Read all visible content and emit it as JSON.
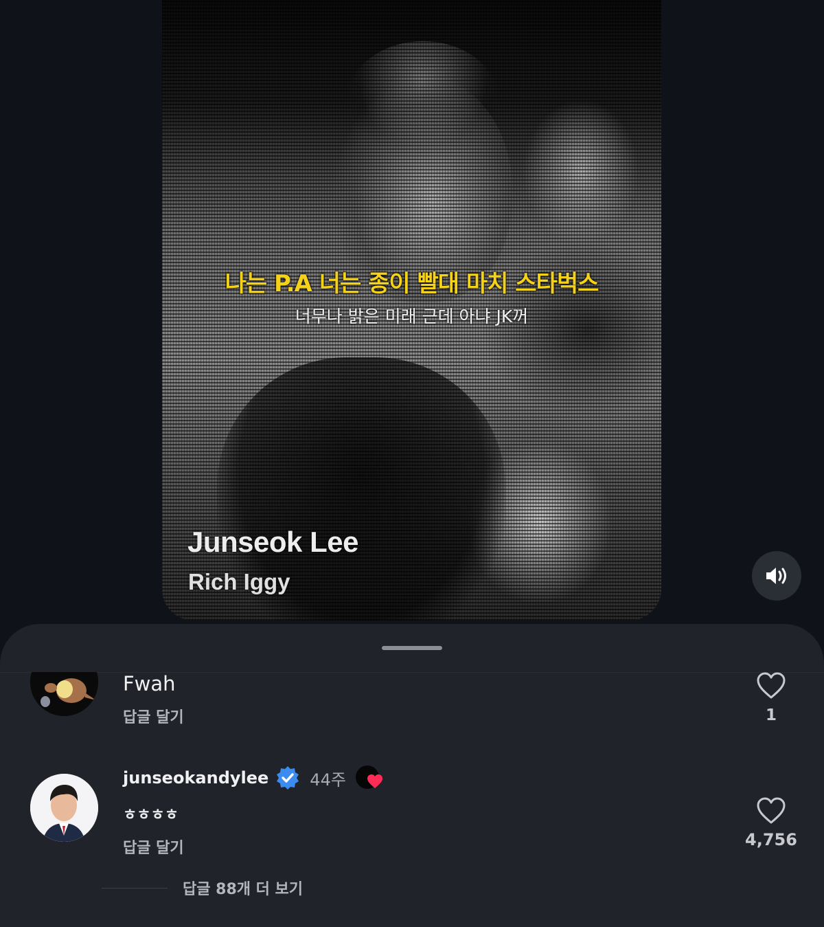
{
  "video": {
    "caption_line1": "나는 P.A 너는 종이 빨대 마치 스타벅스",
    "caption_line2": "너무나 밝은 미래 근데 아냐 JK꺼",
    "artist": "Junseok Lee",
    "song": "Rich Iggy",
    "sound_icon": "speaker-on-icon"
  },
  "comments": [
    {
      "username": "",
      "body": "Fwah",
      "reply_label": "답글 달기",
      "likes": "1",
      "avatar_icon": "dinosaur-avatar"
    },
    {
      "username": "junseokandylee",
      "verified": true,
      "time": "44주",
      "body": "ㅎㅎㅎㅎ",
      "reply_label": "답글 달기",
      "likes": "4,756",
      "creator_liked": true,
      "avatar_icon": "person-avatar"
    }
  ],
  "more_replies_label": "답글 88개 더 보기",
  "colors": {
    "caption_yellow": "#f5d21a",
    "verified_blue": "#3a8cf0",
    "heart_red": "#ff2d55",
    "sheet_bg": "#202329"
  }
}
